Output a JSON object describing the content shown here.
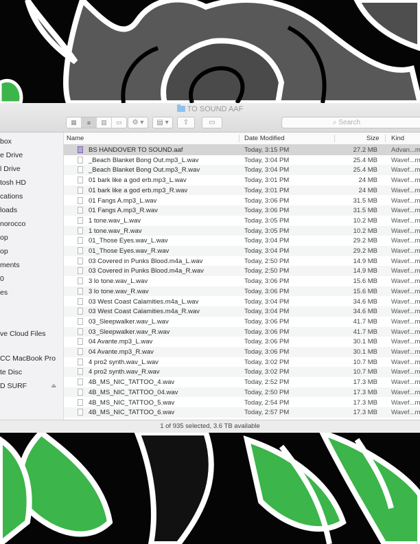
{
  "window": {
    "title": "TO SOUND AAF",
    "search_placeholder": "Search",
    "status": "1 of 935 selected, 3.6 TB available"
  },
  "sidebar": {
    "items": [
      {
        "label": "box"
      },
      {
        "label": "e Drive"
      },
      {
        "label": "l Drive"
      },
      {
        "label": "tosh HD"
      },
      {
        "label": "cations"
      },
      {
        "label": "loads"
      },
      {
        "label": "norocco"
      },
      {
        "label": "op"
      },
      {
        "label": "op"
      },
      {
        "label": "ments"
      },
      {
        "label": "0"
      },
      {
        "label": "es"
      },
      {
        "label": "ve Cloud Files"
      },
      {
        "label": "CC MacBook Pro"
      },
      {
        "label": "te Disc"
      },
      {
        "label": "D SURF"
      }
    ]
  },
  "columns": {
    "name": "Name",
    "date": "Date Modified",
    "size": "Size",
    "kind": "Kind"
  },
  "files": [
    {
      "name": "BS HANDOVER TO SOUND.aaf",
      "date": "Today, 3:15 PM",
      "size": "27.2 MB",
      "kind": "Advan...m"
    },
    {
      "name": "_Beach Blanket Bong Out.mp3_L.wav",
      "date": "Today, 3:04 PM",
      "size": "25.4 MB",
      "kind": "Wavef...m"
    },
    {
      "name": "_Beach Blanket Bong Out.mp3_R.wav",
      "date": "Today, 3:04 PM",
      "size": "25.4 MB",
      "kind": "Wavef...m"
    },
    {
      "name": "01 bark like a god erb.mp3_L.wav",
      "date": "Today, 3:01 PM",
      "size": "24 MB",
      "kind": "Wavef...m"
    },
    {
      "name": "01 bark like a god erb.mp3_R.wav",
      "date": "Today, 3:01 PM",
      "size": "24 MB",
      "kind": "Wavef...m"
    },
    {
      "name": "01 Fangs A.mp3_L.wav",
      "date": "Today, 3:06 PM",
      "size": "31.5 MB",
      "kind": "Wavef...m"
    },
    {
      "name": "01 Fangs A.mp3_R.wav",
      "date": "Today, 3:06 PM",
      "size": "31.5 MB",
      "kind": "Wavef...m"
    },
    {
      "name": "1 tone.wav_L.wav",
      "date": "Today, 3:05 PM",
      "size": "10.2 MB",
      "kind": "Wavef...m"
    },
    {
      "name": "1 tone.wav_R.wav",
      "date": "Today, 3:05 PM",
      "size": "10.2 MB",
      "kind": "Wavef...m"
    },
    {
      "name": "01_Those Eyes.wav_L.wav",
      "date": "Today, 3:04 PM",
      "size": "29.2 MB",
      "kind": "Wavef...m"
    },
    {
      "name": "01_Those Eyes.wav_R.wav",
      "date": "Today, 3:04 PM",
      "size": "29.2 MB",
      "kind": "Wavef...m"
    },
    {
      "name": "03 Covered in Punks Blood.m4a_L.wav",
      "date": "Today, 2:50 PM",
      "size": "14.9 MB",
      "kind": "Wavef...m"
    },
    {
      "name": "03 Covered in Punks Blood.m4a_R.wav",
      "date": "Today, 2:50 PM",
      "size": "14.9 MB",
      "kind": "Wavef...m"
    },
    {
      "name": "3 lo tone.wav_L.wav",
      "date": "Today, 3:06 PM",
      "size": "15.6 MB",
      "kind": "Wavef...m"
    },
    {
      "name": "3 lo tone.wav_R.wav",
      "date": "Today, 3:06 PM",
      "size": "15.6 MB",
      "kind": "Wavef...m"
    },
    {
      "name": "03 West Coast Calamities.m4a_L.wav",
      "date": "Today, 3:04 PM",
      "size": "34.6 MB",
      "kind": "Wavef...m"
    },
    {
      "name": "03 West Coast Calamities.m4a_R.wav",
      "date": "Today, 3:04 PM",
      "size": "34.6 MB",
      "kind": "Wavef...m"
    },
    {
      "name": "03_Sleepwalker.wav_L.wav",
      "date": "Today, 3:06 PM",
      "size": "41.7 MB",
      "kind": "Wavef...m"
    },
    {
      "name": "03_Sleepwalker.wav_R.wav",
      "date": "Today, 3:06 PM",
      "size": "41.7 MB",
      "kind": "Wavef...m"
    },
    {
      "name": "04 Avante.mp3_L.wav",
      "date": "Today, 3:06 PM",
      "size": "30.1 MB",
      "kind": "Wavef...m"
    },
    {
      "name": "04 Avante.mp3_R.wav",
      "date": "Today, 3:06 PM",
      "size": "30.1 MB",
      "kind": "Wavef...m"
    },
    {
      "name": "4 pro2 synth.wav_L.wav",
      "date": "Today, 3:02 PM",
      "size": "10.7 MB",
      "kind": "Wavef...m"
    },
    {
      "name": "4 pro2 synth.wav_R.wav",
      "date": "Today, 3:02 PM",
      "size": "10.7 MB",
      "kind": "Wavef...m"
    },
    {
      "name": "4B_MS_NIC_TATTOO_4.wav",
      "date": "Today, 2:52 PM",
      "size": "17.3 MB",
      "kind": "Wavef...m"
    },
    {
      "name": "4B_MS_NIC_TATTOO_04.wav",
      "date": "Today, 2:50 PM",
      "size": "17.3 MB",
      "kind": "Wavef...m"
    },
    {
      "name": "4B_MS_NIC_TATTOO_5.wav",
      "date": "Today, 2:54 PM",
      "size": "17.3 MB",
      "kind": "Wavef...m"
    },
    {
      "name": "4B_MS_NIC_TATTOO_6.wav",
      "date": "Today, 2:57 PM",
      "size": "17.3 MB",
      "kind": "Wavef...m"
    }
  ],
  "colors": {
    "leaf_green": "#3cb54a",
    "rose_gray": "#5a5a5a",
    "selection": "#d5d5d5"
  }
}
